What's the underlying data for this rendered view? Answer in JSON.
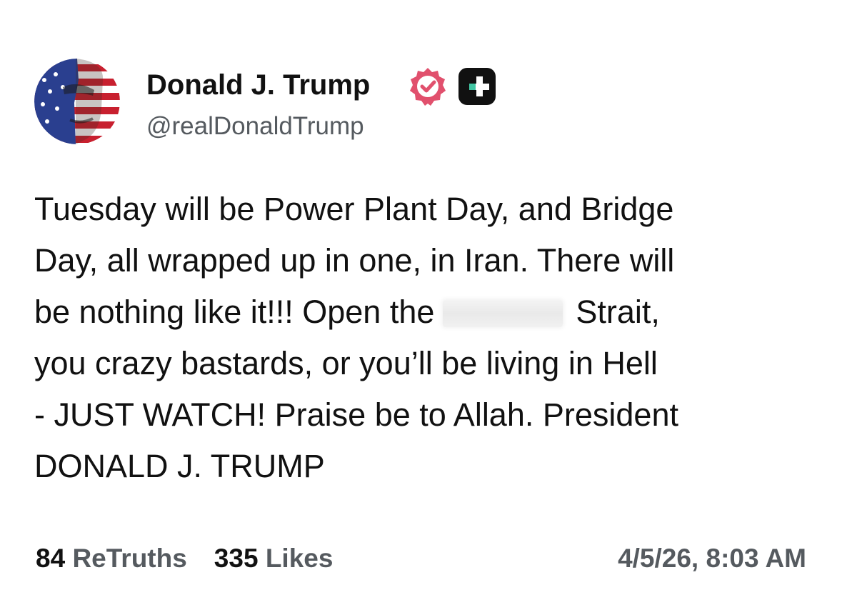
{
  "author": {
    "display_name": "Donald J. Trump",
    "handle": "@realDonaldTrump",
    "avatar_icon": "flag-portrait-avatar",
    "verified_icon": "verified-badge-icon",
    "verified_color": "#e1506d",
    "badge_icon": "plus-badge-icon"
  },
  "post": {
    "lines": [
      "Tuesday will be Power Plant Day, and Bridge",
      "Day, all wrapped up in one, in Iran. There will",
      "be nothing like it!!! Open the",
      "Strait,",
      "you crazy bastards, or you’ll be living in Hell",
      "- JUST WATCH! Praise be to Allah. President",
      "DONALD J. TRUMP"
    ]
  },
  "stats": {
    "retruths_count": "84",
    "retruths_label": "ReTruths",
    "likes_count": "335",
    "likes_label": "Likes",
    "timestamp": "4/5/26, 8:03 AM"
  }
}
